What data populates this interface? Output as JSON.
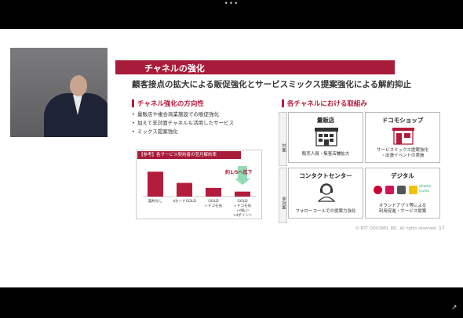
{
  "window": {
    "menu_dots": "•••"
  },
  "slide": {
    "title": "チャネルの強化",
    "headline": "顧客接点の拡大による販促強化とサービスミックス提案強化による解約抑止",
    "left": {
      "heading": "チャネル強化の方向性",
      "bullets": [
        "量販店や複合商業施設での販促強化",
        "加えて非対面チャネルも活用したサービス",
        "ミックス提案強化"
      ]
    },
    "chart_caption": "【参考】各サービス契約者の翌月解約率",
    "chart_annotation": "約1/5へ低下",
    "right": {
      "heading": "各チャネルにおける取組み",
      "row_labels": [
        "対面",
        "非対面"
      ],
      "cells": [
        {
          "title": "量販店",
          "desc": [
            "販売人員・集客店舗拡大"
          ]
        },
        {
          "title": "ドコモショップ",
          "desc": [
            "サービスミックス提案強化",
            "・出張イベントの実施"
          ]
        },
        {
          "title": "コンタクトセンター",
          "desc": [
            "フォローコールでの提案力強化"
          ]
        },
        {
          "title": "デジタル",
          "desc": [
            "オウンドアプリ等による",
            "利用促進・サービス提案"
          ],
          "logo": "ahamo irumo"
        }
      ]
    },
    "footer": "© NTT DOCOMO, INC. All rights reserved.",
    "page_number": "17"
  },
  "chart_data": {
    "type": "bar",
    "title": "【参考】各サービス契約者の翌月解約率",
    "categories": [
      "契約なし",
      "dカードGOLD",
      "GOLD\n+ドコモ光",
      "GOLD\n+ドコモ光\n+d払い\n+dポイント"
    ],
    "category_lines": [
      [
        "契約なし"
      ],
      [
        "dカードGOLD"
      ],
      [
        "GOLD",
        "+ドコモ光"
      ],
      [
        "GOLD",
        "+ドコモ光",
        "+d払い",
        "+dポイント"
      ]
    ],
    "values": [
      1.0,
      0.55,
      0.35,
      0.2
    ],
    "ylim": [
      0,
      1.1
    ],
    "grid": false,
    "bar_color": "#b41c3c",
    "annotation": "約1/5へ低下"
  }
}
